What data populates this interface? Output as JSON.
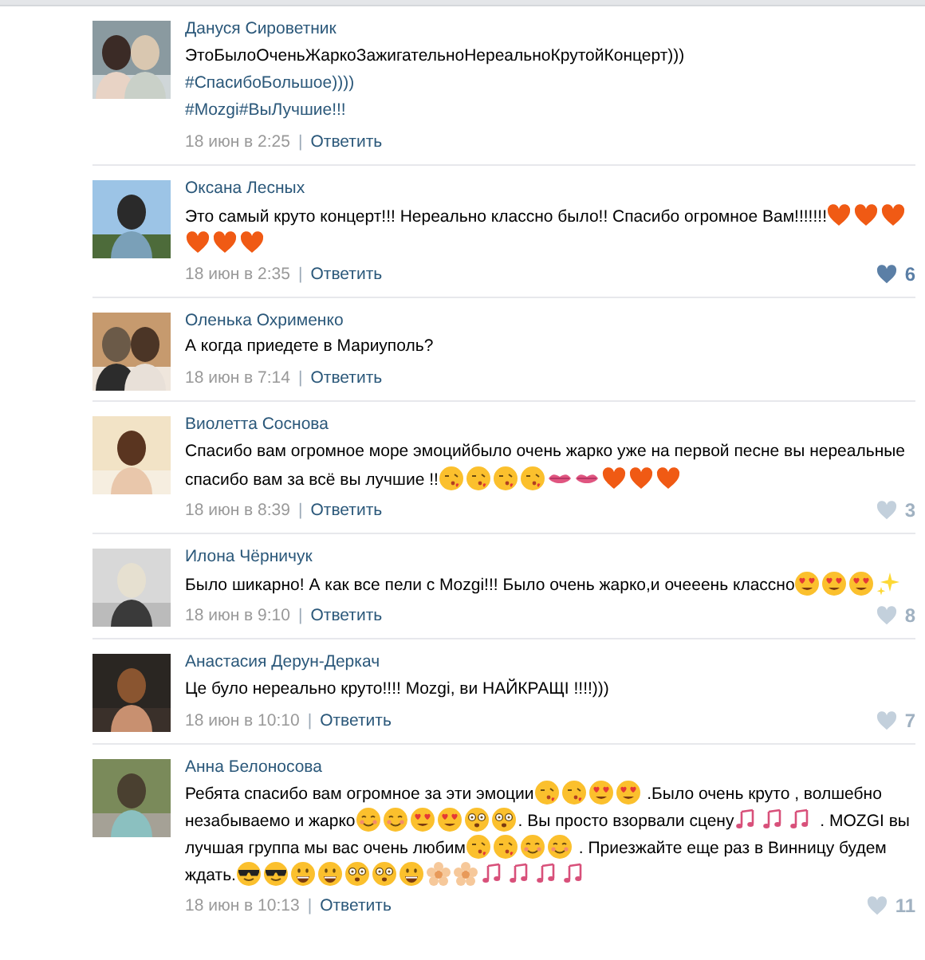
{
  "comments": [
    {
      "author": "Дануся Сироветник",
      "lines": [
        [
          {
            "kind": "text",
            "text": "ЭтоБылоОченьЖаркоЗажигательноНереальноКрутойКонцерт)))"
          }
        ],
        [
          {
            "kind": "hashtag",
            "text": "#СпасибоБольшое))))"
          }
        ],
        [
          {
            "kind": "hashtag",
            "text": "#Mozgi#ВыЛучшие!!!"
          }
        ]
      ],
      "date": "18 июн в 2:25",
      "separator": "|",
      "reply": "Ответить"
    },
    {
      "author": "Оксана Лесных",
      "lines": [
        [
          {
            "kind": "text",
            "text": "Это самый круто концерт!!! Нереально классно было!! Спасибо огромное Вам!!!!!!!"
          },
          {
            "kind": "heart"
          },
          {
            "kind": "heart"
          },
          {
            "kind": "heart"
          }
        ],
        [
          {
            "kind": "heart"
          },
          {
            "kind": "heart"
          },
          {
            "kind": "heart"
          }
        ]
      ],
      "date": "18 июн в 2:35",
      "separator": "|",
      "reply": "Ответить",
      "likes": "6",
      "liked": true
    },
    {
      "author": "Оленька Охрименко",
      "lines": [
        [
          {
            "kind": "text",
            "text": "А когда приедете в Мариуполь?"
          }
        ]
      ],
      "date": "18 июн в 7:14",
      "separator": "|",
      "reply": "Ответить"
    },
    {
      "author": "Виолетта Соснова",
      "lines": [
        [
          {
            "kind": "text",
            "text": "Спасибо вам огромное море эмоцийбыло очень жарко уже на первой песне вы нереальные"
          }
        ],
        [
          {
            "kind": "text",
            "text": "спасибо вам за всё вы лучшие !!"
          },
          {
            "kind": "kiss"
          },
          {
            "kind": "kiss"
          },
          {
            "kind": "kiss"
          },
          {
            "kind": "kiss"
          },
          {
            "kind": "lips"
          },
          {
            "kind": "lips"
          },
          {
            "kind": "heart"
          },
          {
            "kind": "heart"
          },
          {
            "kind": "heart"
          }
        ]
      ],
      "date": "18 июн в 8:39",
      "separator": "|",
      "reply": "Ответить",
      "likes": "3",
      "liked": false
    },
    {
      "author": "Илона Чёрничук",
      "lines": [
        [
          {
            "kind": "text",
            "text": "Было шикарно! А как все пели с Mozgi!!! Было очень жарко,и очееень классно"
          },
          {
            "kind": "hearteyes"
          },
          {
            "kind": "hearteyes"
          },
          {
            "kind": "hearteyes"
          },
          {
            "kind": "sparkles"
          }
        ]
      ],
      "date": "18 июн в 9:10",
      "separator": "|",
      "reply": "Ответить",
      "likes": "8",
      "liked": false
    },
    {
      "author": "Анастасия Дерун-Деркач",
      "lines": [
        [
          {
            "kind": "text",
            "text": "Це було нереально круто!!!! Mozgi, ви НАЙКРАЩІ !!!!)))"
          }
        ]
      ],
      "date": "18 июн в 10:10",
      "separator": "|",
      "reply": "Ответить",
      "likes": "7",
      "liked": false
    },
    {
      "author": "Анна Белоносова",
      "lines": [
        [
          {
            "kind": "text",
            "text": "Ребята спасибо вам огромное за эти эмоции"
          },
          {
            "kind": "kiss"
          },
          {
            "kind": "kiss"
          },
          {
            "kind": "hearteyes"
          },
          {
            "kind": "hearteyes"
          },
          {
            "kind": "text",
            "text": " .Было очень круто , волшебно"
          }
        ],
        [
          {
            "kind": "text",
            "text": "незабываемо и жарко"
          },
          {
            "kind": "smile"
          },
          {
            "kind": "smile"
          },
          {
            "kind": "hearteyes"
          },
          {
            "kind": "hearteyes"
          },
          {
            "kind": "dizzy"
          },
          {
            "kind": "dizzy"
          },
          {
            "kind": "text",
            "text": ". Вы просто взорвали сцену"
          },
          {
            "kind": "notes"
          },
          {
            "kind": "notes"
          },
          {
            "kind": "notes"
          },
          {
            "kind": "text",
            "text": " . MOZGI вы"
          }
        ],
        [
          {
            "kind": "text",
            "text": "лучшая группа мы вас очень любим"
          },
          {
            "kind": "kiss"
          },
          {
            "kind": "kiss"
          },
          {
            "kind": "smile"
          },
          {
            "kind": "smile"
          },
          {
            "kind": "text",
            "text": " . Приезжайте еще раз в Винницу будем"
          }
        ],
        [
          {
            "kind": "text",
            "text": "ждать."
          },
          {
            "kind": "cool"
          },
          {
            "kind": "cool"
          },
          {
            "kind": "grin"
          },
          {
            "kind": "grin"
          },
          {
            "kind": "dizzy"
          },
          {
            "kind": "dizzy"
          },
          {
            "kind": "grin"
          },
          {
            "kind": "flower"
          },
          {
            "kind": "flower"
          },
          {
            "kind": "notes"
          },
          {
            "kind": "notes"
          },
          {
            "kind": "notes"
          },
          {
            "kind": "notes"
          }
        ]
      ],
      "date": "18 июн в 10:13",
      "separator": "|",
      "reply": "Ответить",
      "likes": "11",
      "liked": false
    }
  ]
}
